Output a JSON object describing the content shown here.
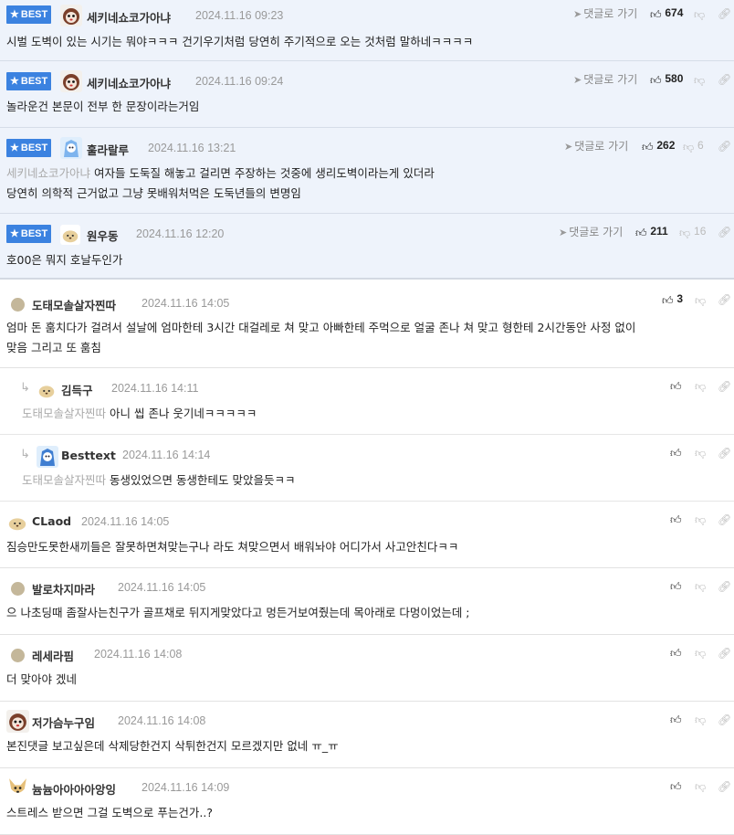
{
  "best_label": "BEST",
  "goto_label": "댓글로 가기",
  "comments": [
    {
      "nick": "세키네쇼코가아냐",
      "date": "2024.11.16 09:23",
      "up": "674",
      "down": "",
      "lines": [
        "시벌 도벽이 있는 시기는 뭐야ㅋㅋㅋ 건기우기처럼 당연히 주기적으로 오는 것처럼 말하네ㅋㅋㅋㅋ"
      ]
    },
    {
      "nick": "세키네쇼코가아냐",
      "date": "2024.11.16 09:24",
      "up": "580",
      "down": "",
      "lines": [
        "놀라운건 본문이 전부 한 문장이라는거임"
      ]
    },
    {
      "nick": "훌라랄루",
      "date": "2024.11.16 13:21",
      "up": "262",
      "down": "6",
      "target": "세키네쇼코가아냐",
      "lines": [
        "여자들 도둑질 해놓고 걸리면 주장하는 것중에 생리도벽이라는게 있더라",
        "당연히 의학적 근거없고 그냥 못배워처먹은 도둑년들의 변명임"
      ]
    },
    {
      "nick": "원우동",
      "date": "2024.11.16 12:20",
      "up": "211",
      "down": "16",
      "lines": [
        "호00은 뭐지 호날두인가"
      ]
    },
    {
      "nick": "도태모솔살자찐따",
      "date": "2024.11.16 14:05",
      "up": "3",
      "down": "",
      "lines": [
        "엄마 돈 훔치다가 걸려서 설날에 엄마한테 3시간 대걸레로 쳐 맞고 아빠한테 주먹으로 얼굴 존나 쳐 맞고 형한테 2시간동안 사정 없이",
        "맞음 그리고 또 훔침"
      ]
    },
    {
      "nick": "김득구",
      "date": "2024.11.16 14:11",
      "target": "도태모솔살자찐따",
      "lines": [
        "아니 씹 존나 웃기네ㅋㅋㅋㅋㅋ"
      ]
    },
    {
      "nick": "Besttext",
      "date": "2024.11.16 14:14",
      "target": "도태모솔살자찐따",
      "lines": [
        "동생있었으면 동생한테도 맞았을듯ㅋㅋ"
      ]
    },
    {
      "nick": "CLaod",
      "date": "2024.11.16 14:05",
      "lines": [
        "짐승만도못한새끼들은 잘못하면쳐맞는구나 라도 쳐맞으면서 배워놔야 어디가서 사고안친다ㅋㅋ"
      ]
    },
    {
      "nick": "발로차지마라",
      "date": "2024.11.16 14:05",
      "lines": [
        "으 나초딩때 좀잘사는친구가 골프채로 뒤지게맞았다고 멍든거보여줬는데 목아래로 다멍이었는데 ;"
      ]
    },
    {
      "nick": "레세라핌",
      "date": "2024.11.16 14:08",
      "lines": [
        "더 맞아야 겠네"
      ]
    },
    {
      "nick": "저가슴누구임",
      "date": "2024.11.16 14:08",
      "lines": [
        "본진댓글 보고싶은데 삭제당한건지 삭튀한건지 모르겠지만 없네 ㅠ_ㅠ"
      ]
    },
    {
      "nick": "늄늄아아아아앙잉",
      "date": "2024.11.16 14:09",
      "lines": [
        "스트레스 받으면 그걸 도벽으로 푸는건가..?"
      ]
    }
  ]
}
